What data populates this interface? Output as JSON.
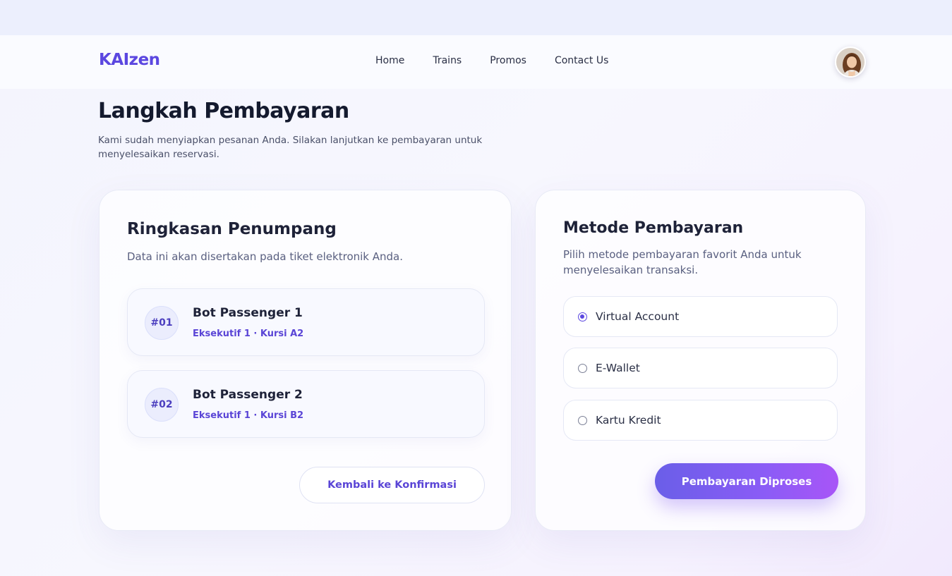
{
  "brand": "KAIzen",
  "nav": {
    "links": [
      "Home",
      "Trains",
      "Promos",
      "Contact Us"
    ]
  },
  "page": {
    "title": "Langkah Pembayaran",
    "description": "Kami sudah menyiapkan pesanan Anda. Silakan lanjutkan ke pembayaran untuk menyelesaikan reservasi."
  },
  "passengers_card": {
    "title": "Ringkasan Penumpang",
    "subtitle": "Data ini akan disertakan pada tiket elektronik Anda.",
    "passengers": [
      {
        "number": "#01",
        "name": "Bot Passenger 1",
        "seat": "Eksekutif 1 · Kursi A2"
      },
      {
        "number": "#02",
        "name": "Bot Passenger 2",
        "seat": "Eksekutif 1 · Kursi B2"
      }
    ],
    "back_button": "Kembali ke Konfirmasi"
  },
  "payment_card": {
    "title": "Metode Pembayaran",
    "subtitle": "Pilih metode pembayaran favorit Anda untuk menyelesaikan transaksi.",
    "methods": [
      {
        "label": "Virtual Account",
        "selected": true
      },
      {
        "label": "E-Wallet",
        "selected": false
      },
      {
        "label": "Kartu Kredit",
        "selected": false
      }
    ],
    "submit_button": "Pembayaran Diproses"
  },
  "colors": {
    "accent": "#5b47e0",
    "button_gradient_start": "#6a5ee8",
    "button_gradient_end": "#a855f7",
    "title_text": "#141a2e"
  },
  "icons": {
    "avatar": "user-avatar-photo",
    "radio": "radio-button"
  }
}
